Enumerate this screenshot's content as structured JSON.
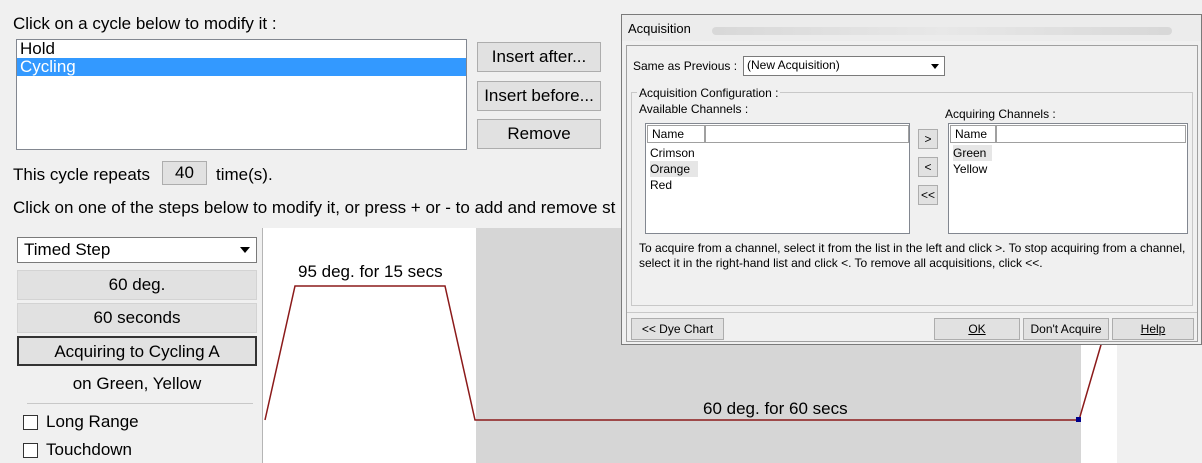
{
  "cycles": {
    "prompt": "Click on a cycle below to modify it :",
    "items": [
      "Hold",
      "Cycling"
    ],
    "selected_index": 1,
    "insert_after": "Insert after...",
    "insert_before": "Insert before...",
    "remove": "Remove",
    "repeat_prefix": "This cycle repeats",
    "repeat_count": "40",
    "repeat_suffix": "time(s).",
    "steps_prompt": "Click on one of the steps below to modify it, or press + or - to add and remove st"
  },
  "step": {
    "type": "Timed Step",
    "temperature": "60 deg.",
    "duration": "60 seconds",
    "acquiring": "Acquiring to Cycling A",
    "channels": "on Green, Yellow",
    "long_range": "Long Range",
    "touchdown": "Touchdown"
  },
  "chart": {
    "label_high": "95 deg. for 15 secs",
    "label_low": "60 deg. for 60 secs",
    "line_color": "#8b1a1a",
    "shade_color": "#d6d6d6"
  },
  "dialog": {
    "title": "Acquisition",
    "same_as_previous_label": "Same as Previous :",
    "same_as_previous_value": "(New Acquisition)",
    "group_label": "Acquisition Configuration :",
    "available_label": "Available Channels :",
    "acquiring_label": "Acquiring Channels :",
    "column_name": "Name",
    "available": [
      "Crimson",
      "Orange",
      "Red"
    ],
    "acquiring": [
      "Green",
      "Yellow"
    ],
    "add_btn": ">",
    "remove_btn": "<",
    "remove_all_btn": "<<",
    "help_text": "To acquire from a channel, select it from the list in the left and click >. To stop acquiring from a channel, select it in the right-hand list and click <. To remove all acquisitions, click <<.",
    "dye_chart": "<< Dye Chart",
    "ok": "OK",
    "dont_acquire": "Don't Acquire",
    "help": "Help"
  }
}
